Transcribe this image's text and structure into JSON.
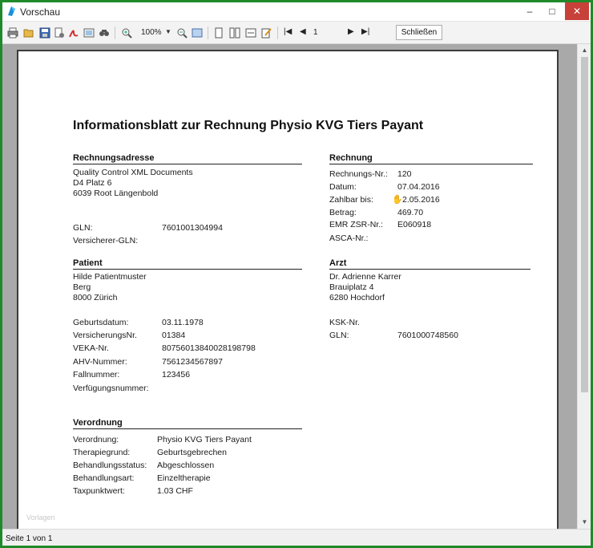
{
  "window": {
    "title": "Vorschau",
    "controls": {
      "minimize": "–",
      "maximize": "□",
      "close": "✕"
    }
  },
  "toolbar": {
    "zoom": "100%",
    "page_number": "1",
    "close_label": "Schließen"
  },
  "status": {
    "text": "Seite 1 von 1"
  },
  "document": {
    "title": "Informationsblatt zur Rechnung Physio KVG Tiers Payant",
    "rechnungsadresse": {
      "heading": "Rechnungsadresse",
      "lines": [
        "Quality Control XML Documents",
        "D4 Platz 6",
        "6039 Root Längenbold"
      ],
      "gln_label": "GLN:",
      "gln_value": "7601001304994",
      "versicherer_label": "Versicherer-GLN:"
    },
    "rechnung": {
      "heading": "Rechnung",
      "rows": [
        {
          "label": "Rechnungs-Nr.:",
          "value": "120"
        },
        {
          "label": "Datum:",
          "value": "07.04.2016"
        },
        {
          "label": "Zahlbar bis:",
          "value": "2.05.2016"
        },
        {
          "label": "Betrag:",
          "value": "469.70"
        },
        {
          "label": "EMR ZSR-Nr.:",
          "value": "E060918"
        },
        {
          "label": "ASCA-Nr.:",
          "value": ""
        }
      ]
    },
    "patient": {
      "heading": "Patient",
      "lines": [
        "Hilde Patientmuster",
        "Berg",
        "8000 Zürich"
      ],
      "rows": [
        {
          "label": "Geburtsdatum:",
          "value": "03.11.1978"
        },
        {
          "label": "VersicherungsNr.",
          "value": "01384"
        },
        {
          "label": "VEKA-Nr.",
          "value": "80756013840028198798"
        },
        {
          "label": "AHV-Nummer:",
          "value": "7561234567897"
        },
        {
          "label": "Fallnummer:",
          "value": "123456"
        },
        {
          "label": "Verfügungsnummer:",
          "value": ""
        }
      ]
    },
    "arzt": {
      "heading": "Arzt",
      "lines": [
        "Dr. Adrienne Karrer",
        "Brauiplatz 4",
        "6280 Hochdorf"
      ],
      "ksk_label": "KSK-Nr.",
      "gln_label": "GLN:",
      "gln_value": "7601000748560"
    },
    "verordnung": {
      "heading": "Verordnung",
      "rows": [
        {
          "label": "Verordnung:",
          "value": "Physio KVG Tiers Payant"
        },
        {
          "label": "Therapiegrund:",
          "value": "Geburtsgebrechen"
        },
        {
          "label": "Behandlungsstatus:",
          "value": "Abgeschlossen"
        },
        {
          "label": "Behandlungsart:",
          "value": "Einzeltherapie"
        },
        {
          "label": "Taxpunktwert:",
          "value": "1.03 CHF"
        }
      ]
    },
    "footer": "Vorlagen"
  }
}
